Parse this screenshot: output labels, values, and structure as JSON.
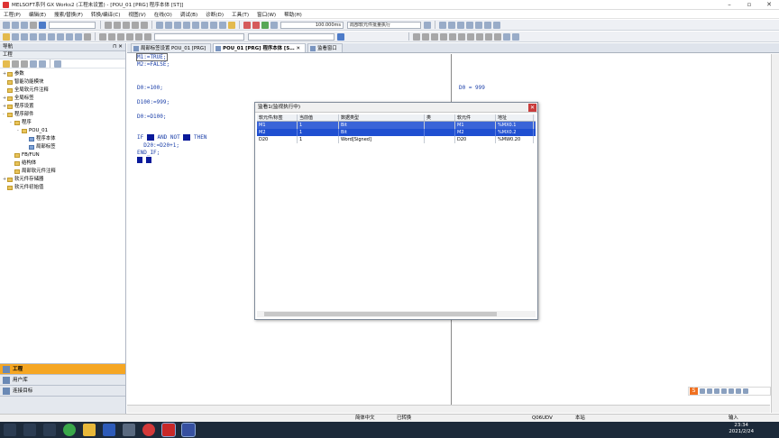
{
  "window": {
    "title": "MELSOFT系列 GX Works2 (工程未设置) - [POU_01 [PRG] 程序本体 [ST]]"
  },
  "menu": [
    "工程(P)",
    "编辑(E)",
    "搜索/替换(F)",
    "转换/编译(C)",
    "视图(V)",
    "在线(O)",
    "调试(B)",
    "诊断(D)",
    "工具(T)",
    "窗口(W)",
    "帮助(H)"
  ],
  "toolbar": {
    "interval": "100.000ms",
    "mode": "局部软元件批量执行"
  },
  "nav": {
    "header": "导航",
    "sub": "工程",
    "tree": [
      {
        "label": "参数",
        "level": 0,
        "exp": "+"
      },
      {
        "label": "智能功能模块",
        "level": 0,
        "exp": ""
      },
      {
        "label": "全局软元件注释",
        "level": 0,
        "exp": ""
      },
      {
        "label": "全局标签",
        "level": 0,
        "exp": "+"
      },
      {
        "label": "程序设置",
        "level": 0,
        "exp": "+"
      },
      {
        "label": "程序部件",
        "level": 0,
        "exp": "-"
      },
      {
        "label": "程序",
        "level": 1,
        "exp": "-"
      },
      {
        "label": "POU_01",
        "level": 2,
        "exp": "-"
      },
      {
        "label": "程序本体",
        "level": 3,
        "exp": ""
      },
      {
        "label": "局部标签",
        "level": 3,
        "exp": ""
      },
      {
        "label": "FB/FUN",
        "level": 1,
        "exp": ""
      },
      {
        "label": "结构体",
        "level": 1,
        "exp": ""
      },
      {
        "label": "局部软元件注释",
        "level": 1,
        "exp": ""
      },
      {
        "label": "软元件存储器",
        "level": 0,
        "exp": "+"
      },
      {
        "label": "软元件初始值",
        "level": 0,
        "exp": ""
      }
    ],
    "bottom": [
      "工程",
      "用户库",
      "连接目标"
    ]
  },
  "tabs": [
    "局部标签设置 POU_01 [PRG]",
    "POU_01 [PRG] 程序本体 [S…",
    "监看窗口"
  ],
  "code_left": [
    {
      "pre": "",
      "txt": "M1:=TRUE;"
    },
    {
      "pre": "",
      "txt": "M2:=FALSE;"
    },
    {
      "pre": "",
      "txt": "D0:=100;"
    },
    {
      "pre": "",
      "txt": "D100:=999;"
    },
    {
      "pre": "",
      "txt": "D0:=D100;"
    },
    {
      "pre": "",
      "txt": "IF  ▮  AND NOT  ▮  THEN"
    },
    {
      "pre": "",
      "txt": "  D20:=D20+1;"
    },
    {
      "pre": "",
      "txt": "END_IF;"
    }
  ],
  "code_right": {
    "line1": "D0 = 999"
  },
  "dialog": {
    "title": "监看1(监视执行中)",
    "columns": [
      "软元件/标签",
      "当前值",
      "数据类型",
      "类",
      "软元件",
      "地址"
    ],
    "rows": [
      [
        "M1",
        "1",
        "Bit",
        "",
        "M1",
        "%MX0.1"
      ],
      [
        "M2",
        "1",
        "Bit",
        "",
        "M2",
        "%MX0.2"
      ],
      [
        "D20",
        "1",
        "Word[Signed]",
        "",
        "D20",
        "%MW0.20"
      ]
    ]
  },
  "status": {
    "lang": "简体中文",
    "state": "已转换",
    "cpu": "Q06UDV",
    "host": "本站",
    "mode": "输入"
  },
  "taskbar": {
    "time": "23:34",
    "date": "2021/2/24"
  }
}
